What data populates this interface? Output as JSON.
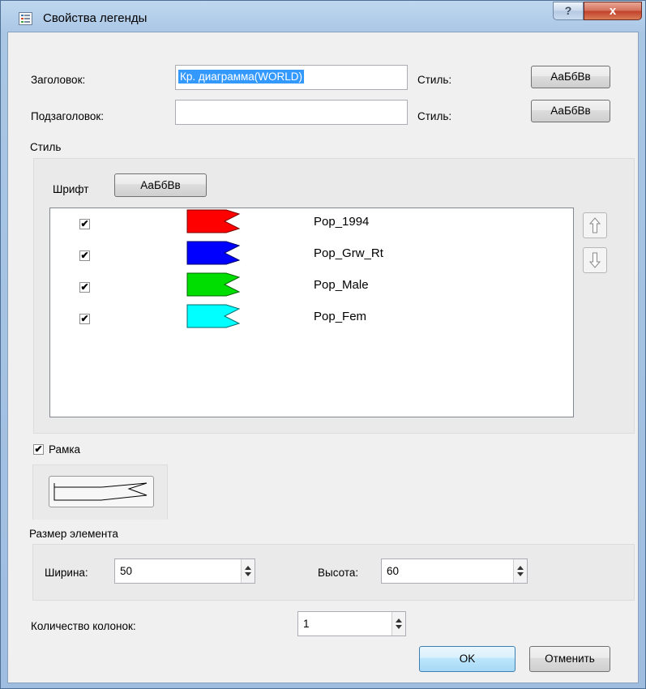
{
  "window": {
    "title": "Свойства легенды",
    "help_label": "?",
    "close_label": "x"
  },
  "header": {
    "title_label": "Заголовок:",
    "title_value": "Кр. диаграмма(WORLD)",
    "subtitle_label": "Подзаголовок:",
    "subtitle_value": "",
    "style_label": "Стиль:",
    "style_button": "АаБбВв"
  },
  "style_group": {
    "title": "Стиль",
    "font_label": "Шрифт",
    "font_button": "АаБбВв",
    "items": [
      {
        "checked": true,
        "label": "Pop_1994",
        "color": "#ff0000"
      },
      {
        "checked": true,
        "label": "Pop_Grw_Rt",
        "color": "#0000ff"
      },
      {
        "checked": true,
        "label": "Pop_Male",
        "color": "#00dd00"
      },
      {
        "checked": true,
        "label": "Pop_Fem",
        "color": "#00ffff"
      }
    ],
    "move_up_icon": "arrow-up-icon",
    "move_down_icon": "arrow-down-icon"
  },
  "frame": {
    "checked": true,
    "label": "Рамка"
  },
  "element_size": {
    "title": "Размер элемента",
    "width_label": "Ширина:",
    "width_value": "50",
    "height_label": "Высота:",
    "height_value": "60"
  },
  "columns": {
    "label": "Количество колонок:",
    "value": "1"
  },
  "footer": {
    "ok_label": "OK",
    "cancel_label": "Отменить"
  },
  "checkmark": "✔"
}
